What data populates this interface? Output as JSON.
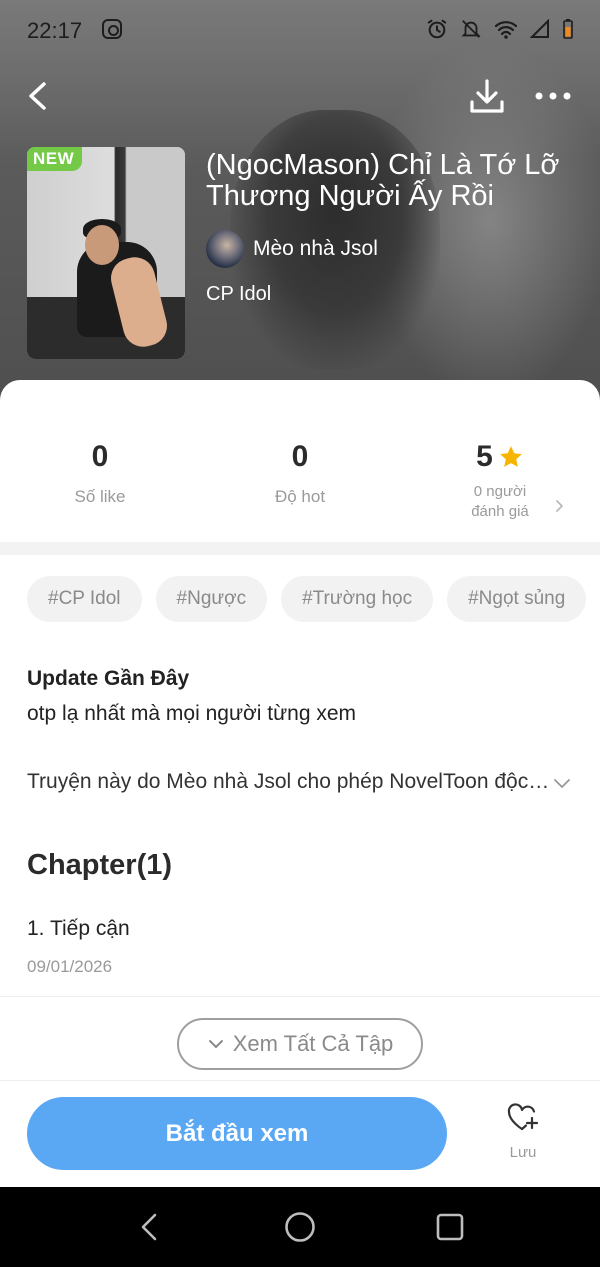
{
  "status_bar": {
    "time": "22:17"
  },
  "story": {
    "badge": "NEW",
    "title": "(NgocMason) Chỉ Là Tớ Lỡ Thương Người Ấy Rồi",
    "author": "Mèo nhà Jsol",
    "category": "CP Idol"
  },
  "stats": {
    "likes_value": "0",
    "likes_label": "Số like",
    "hot_value": "0",
    "hot_label": "Độ hot",
    "rating_value": "5",
    "rating_label_line1": "0 người",
    "rating_label_line2": "đánh giá"
  },
  "tags": [
    "#CP Idol",
    "#Ngược",
    "#Trường học",
    "#Ngọt sủng"
  ],
  "update": {
    "heading": "Update Gần Đây",
    "text": "otp lạ nhất mà mọi người từng xem"
  },
  "description": "Truyện này do Mèo nhà Jsol cho phép NovelToon độc quyền phát hành",
  "chapters": {
    "heading": "Chapter(1)",
    "items": [
      {
        "name": "1. Tiếp cận",
        "date": "09/01/2026"
      }
    ],
    "see_all_label": "Xem Tất Cả Tập"
  },
  "actions": {
    "start_label": "Bắt đầu xem",
    "save_label": "Lưu"
  },
  "colors": {
    "primary": "#5aa8f3",
    "badge_new": "#74c947",
    "star": "#f7b500",
    "tag_bg": "#f2f2f2"
  }
}
